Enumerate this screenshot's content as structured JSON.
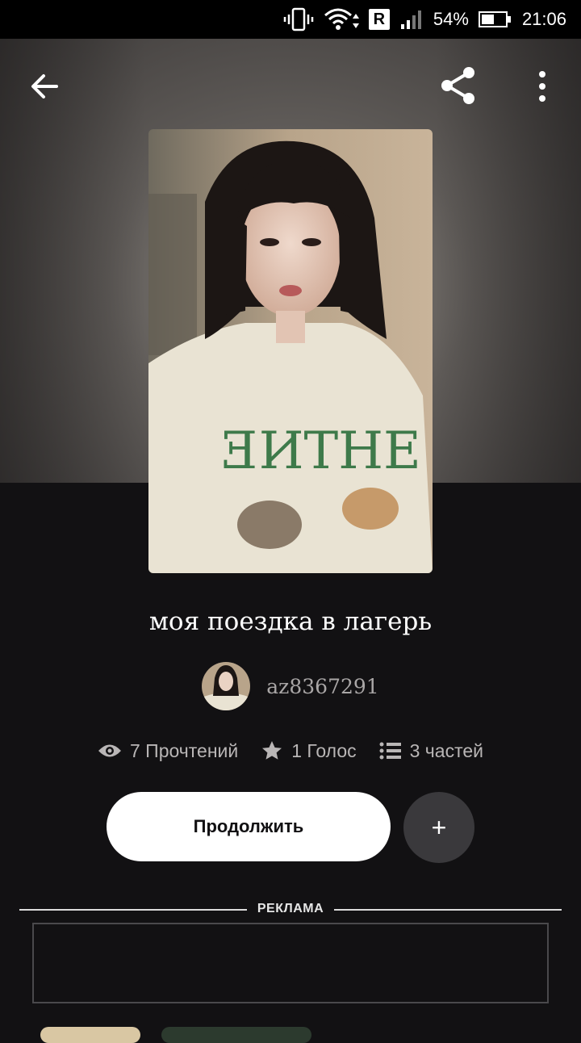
{
  "status_bar": {
    "signal_r": "R",
    "battery_percent": "54%",
    "battery_level": 0.54,
    "time": "21:06"
  },
  "toolbar": {
    "back_icon": "arrow-left-icon",
    "share_icon": "share-icon",
    "more_icon": "more-vertical-icon"
  },
  "story": {
    "title": "моя поездка в лагерь",
    "author": "az8367291",
    "reads": "7 Прочтений",
    "votes": "1 Голос",
    "parts": "3 частей"
  },
  "actions": {
    "continue_label": "Продолжить",
    "add_label": "+"
  },
  "ad": {
    "label": "РЕКЛАМА"
  },
  "colors": {
    "background": "#121113",
    "primary_button": "#ffffff",
    "secondary_button": "#3a393c",
    "muted_text": "#b9b6b6"
  }
}
